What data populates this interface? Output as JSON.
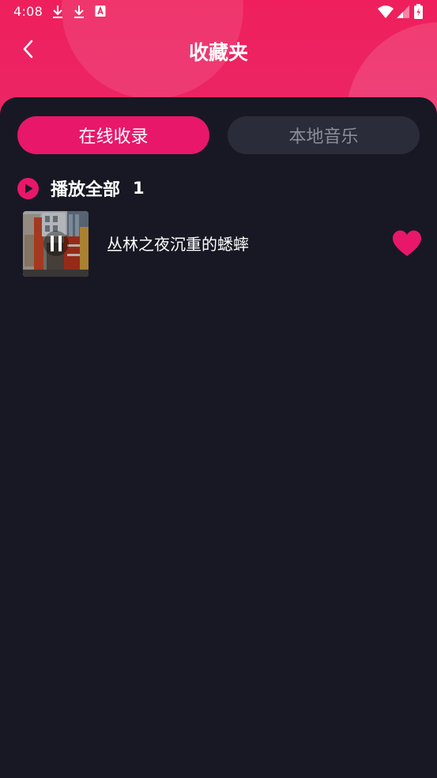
{
  "status_bar": {
    "time": "4:08",
    "icons": [
      "download-icon",
      "download-icon",
      "a-notification-icon",
      "wifi-icon",
      "signal-icon",
      "battery-icon"
    ]
  },
  "header": {
    "title": "收藏夹",
    "back_icon": "chevron-left-icon"
  },
  "tabs": [
    {
      "label": "在线收录",
      "active": true
    },
    {
      "label": "本地音乐",
      "active": false
    }
  ],
  "play_all": {
    "icon": "play-circle-icon",
    "label": "播放全部",
    "count": "1"
  },
  "songs": [
    {
      "title": "丛林之夜沉重的蟋蟀",
      "state_icon": "pause-icon",
      "favorite_icon": "heart-icon",
      "favorited": true
    }
  ],
  "colors": {
    "header_pink": "#ee1f5c",
    "accent": "#e8176a",
    "background": "#181824",
    "inactive_tab": "#2a2c3a",
    "inactive_tab_text": "#8b8d98"
  }
}
